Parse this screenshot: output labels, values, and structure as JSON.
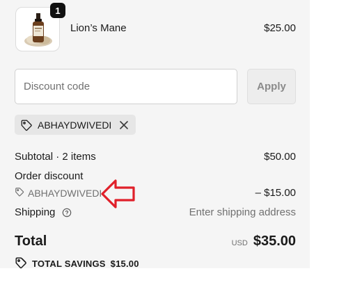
{
  "product": {
    "quantity": "1",
    "name": "Lion’s Mane",
    "price": "$25.00"
  },
  "discount": {
    "placeholder": "Discount code",
    "apply_label": "Apply",
    "applied_code": "ABHAYDWIVEDI"
  },
  "summary": {
    "subtotal_label": "Subtotal · 2 items",
    "subtotal_value": "$50.00",
    "order_discount_label": "Order discount",
    "order_discount_code": "ABHAYDWIVEDI",
    "order_discount_value": "– $15.00",
    "shipping_label": "Shipping",
    "shipping_value": "Enter shipping address",
    "total_label": "Total",
    "currency": "USD",
    "total_value": "$35.00",
    "savings_label": "TOTAL SAVINGS",
    "savings_value": "$15.00"
  },
  "colors": {
    "panel_bg": "#f5f5f5",
    "annotation_arrow": "#e0202a",
    "muted_text": "#707070"
  }
}
